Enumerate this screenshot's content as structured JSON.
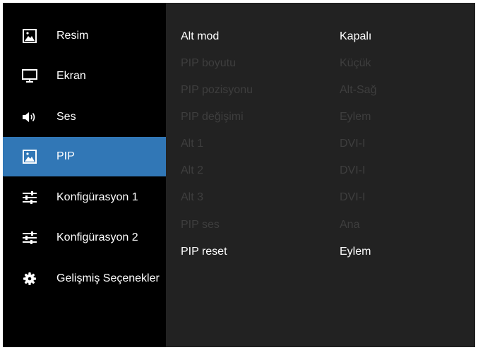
{
  "sidebar": {
    "items": [
      {
        "label": "Resim",
        "icon": "image-icon"
      },
      {
        "label": "Ekran",
        "icon": "monitor-icon"
      },
      {
        "label": "Ses",
        "icon": "speaker-icon"
      },
      {
        "label": "PIP",
        "icon": "pip-image-icon",
        "active": true
      },
      {
        "label": "Konfigürasyon 1",
        "icon": "sliders-icon"
      },
      {
        "label": "Konfigürasyon 2",
        "icon": "sliders-icon"
      },
      {
        "label": "Gelişmiş Seçenekler",
        "icon": "gear-icon"
      }
    ]
  },
  "settings": {
    "rows": [
      {
        "label": "Alt mod",
        "value": "Kapalı",
        "enabled": true
      },
      {
        "label": "PIP boyutu",
        "value": "Küçük",
        "enabled": false
      },
      {
        "label": "PIP pozisyonu",
        "value": "Alt-Sağ",
        "enabled": false
      },
      {
        "label": "PIP değişimi",
        "value": "Eylem",
        "enabled": false
      },
      {
        "label": "Alt 1",
        "value": "DVI-I",
        "enabled": false
      },
      {
        "label": "Alt 2",
        "value": "DVI-I",
        "enabled": false
      },
      {
        "label": "Alt 3",
        "value": "DVI-I",
        "enabled": false
      },
      {
        "label": "PIP ses",
        "value": "Ana",
        "enabled": false
      },
      {
        "label": "PIP reset",
        "value": "Eylem",
        "enabled": true
      }
    ]
  },
  "colors": {
    "sidebar_bg": "#000000",
    "content_bg": "#222222",
    "active": "#3177b6",
    "text": "#ffffff",
    "disabled_text": "#3e3e3e"
  }
}
